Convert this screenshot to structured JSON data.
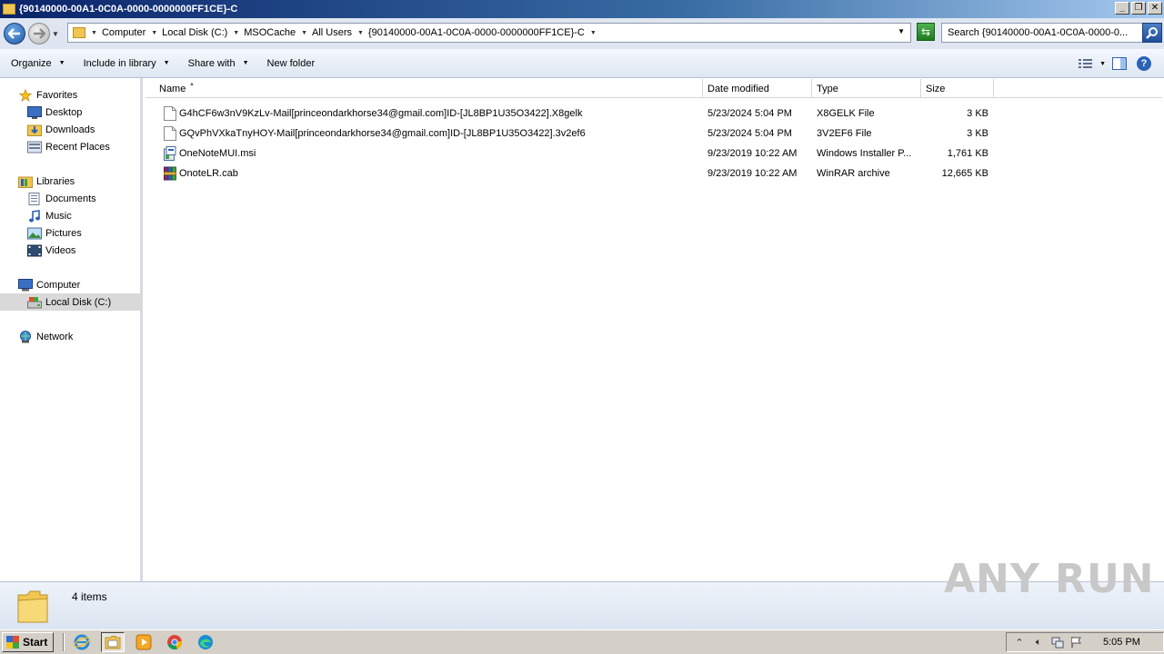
{
  "window": {
    "title": "{90140000-00A1-0C0A-0000-0000000FF1CE}-C",
    "controls": [
      "minimize",
      "restore",
      "close"
    ]
  },
  "address": {
    "crumbs": [
      "Computer",
      "Local Disk (C:)",
      "MSOCache",
      "All Users",
      "{90140000-00A1-0C0A-0000-0000000FF1CE}-C"
    ],
    "search_placeholder": "Search {90140000-00A1-0C0A-0000-0..."
  },
  "toolbar": {
    "organize": "Organize",
    "include_in_library": "Include in library",
    "share_with": "Share with",
    "new_folder": "New folder"
  },
  "sidebar": {
    "favorites": {
      "label": "Favorites",
      "items": [
        "Desktop",
        "Downloads",
        "Recent Places"
      ]
    },
    "libraries": {
      "label": "Libraries",
      "items": [
        "Documents",
        "Music",
        "Pictures",
        "Videos"
      ]
    },
    "computer": {
      "label": "Computer",
      "items": [
        "Local Disk (C:)"
      ]
    },
    "network": {
      "label": "Network"
    }
  },
  "columns": {
    "name": "Name",
    "date": "Date modified",
    "type": "Type",
    "size": "Size"
  },
  "files": [
    {
      "name": "G4hCF6w3nV9KzLv-Mail[princeondarkhorse34@gmail.com]ID-[JL8BP1U35O3422].X8gelk",
      "date": "5/23/2024 5:04 PM",
      "type": "X8GELK File",
      "size": "3 KB",
      "icon": "blank-file-icon"
    },
    {
      "name": "GQvPhVXkaTnyHOY-Mail[princeondarkhorse34@gmail.com]ID-[JL8BP1U35O3422].3v2ef6",
      "date": "5/23/2024 5:04 PM",
      "type": "3V2EF6 File",
      "size": "3 KB",
      "icon": "blank-file-icon"
    },
    {
      "name": "OneNoteMUI.msi",
      "date": "9/23/2019 10:22 AM",
      "type": "Windows Installer P...",
      "size": "1,761 KB",
      "icon": "msi-installer-icon"
    },
    {
      "name": "OnoteLR.cab",
      "date": "9/23/2019 10:22 AM",
      "type": "WinRAR archive",
      "size": "12,665 KB",
      "icon": "winrar-archive-icon"
    }
  ],
  "status": {
    "item_count": "4 items"
  },
  "watermark": "ANY RUN",
  "taskbar": {
    "start_label": "Start",
    "clock": "5:05 PM"
  },
  "colors": {
    "title_gradient_start": "#0a246a",
    "title_gradient_end": "#a6caf0",
    "selection": "#d9d9d9"
  }
}
